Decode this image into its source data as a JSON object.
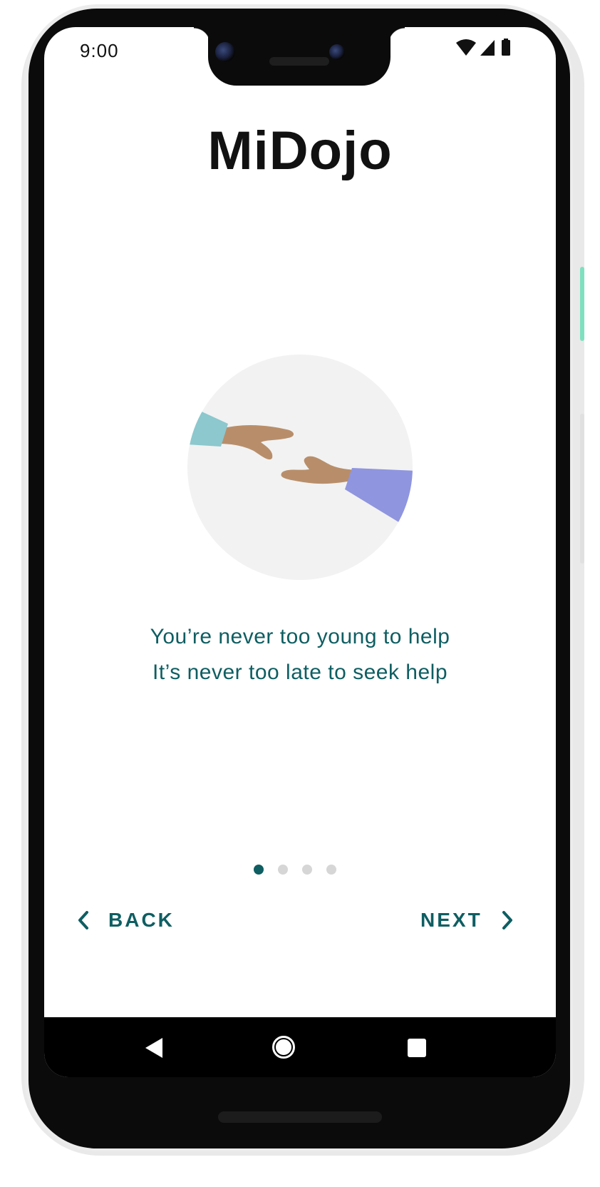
{
  "status_bar": {
    "time": "9:00",
    "icons": [
      "wifi-icon",
      "cell-signal-icon",
      "battery-icon"
    ]
  },
  "app": {
    "title": "MiDojo"
  },
  "onboarding": {
    "illustration": "helping-hands-illustration",
    "line1": "You’re never too young to help",
    "line2": "It’s never too late to seek help",
    "page_indicator": {
      "current": 1,
      "total": 4
    }
  },
  "navigation": {
    "back_label": "BACK",
    "next_label": "NEXT"
  },
  "system_nav": {
    "keys": [
      "back-triangle-icon",
      "home-circle-icon",
      "recents-square-icon"
    ]
  },
  "colors": {
    "accent": "#0e5e62",
    "left_sleeve": "#8cc8ce",
    "right_sleeve": "#8f95de",
    "skin": "#b88e6a",
    "circle_bg": "#f2f2f2"
  }
}
